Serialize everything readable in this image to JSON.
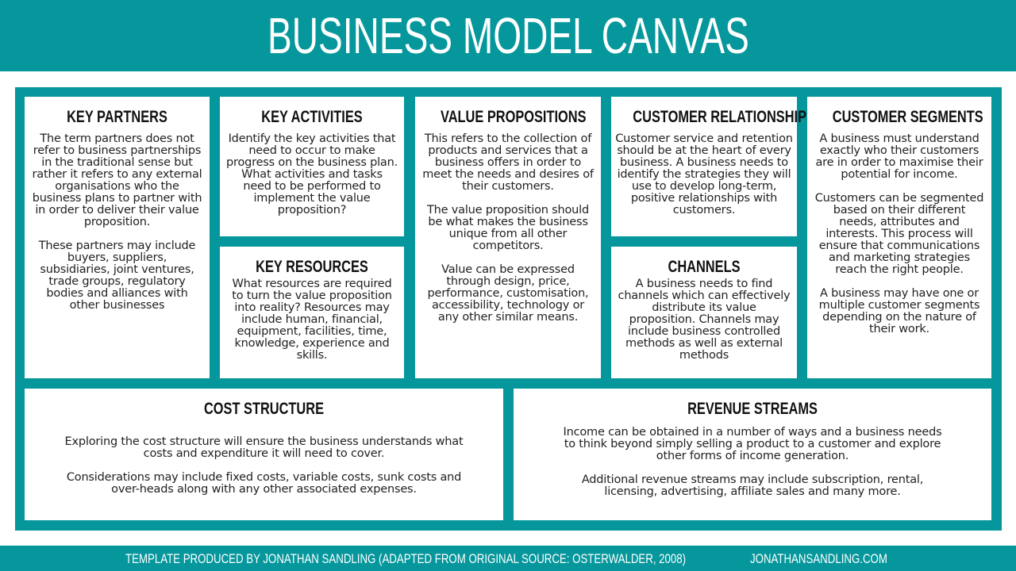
{
  "title": "BUSINESS MODEL CANVAS",
  "colors": {
    "brand_teal": "#05979c",
    "box_bg": "#ffffff",
    "text": "#222222"
  },
  "blocks": {
    "key_partners": {
      "heading": "KEY PARTNERS",
      "paragraphs": [
        "The term partners does not refer to business partnerships in the traditional sense but rather it refers to any external organisations who the business plans to partner with in order to deliver their value proposition.",
        "These partners may include buyers, suppliers, subsidiaries, joint ventures, trade groups, regulatory bodies and alliances with other businesses"
      ]
    },
    "key_activities": {
      "heading": "KEY ACTIVITIES",
      "paragraphs": [
        "Identify the key activities that need to occur to make progress on the business plan. What activities and tasks need to be performed to implement the value proposition?"
      ]
    },
    "key_resources": {
      "heading": "KEY RESOURCES",
      "paragraphs": [
        "What resources are required to turn the value proposition into reality? Resources may include human, financial, equipment, facilities, time, knowledge, experience and skills."
      ]
    },
    "value_propositions": {
      "heading": "VALUE PROPOSITIONS",
      "paragraphs": [
        "This refers to the collection of products and services that a business offers in order to meet the needs and desires of their customers.",
        "The value proposition should be what makes the business unique from all other competitors.",
        "Value can be expressed through design, price, performance, customisation, accessibility, technology or any other similar means."
      ]
    },
    "customer_relationships": {
      "heading": "CUSTOMER RELATIONSHIPS",
      "paragraphs": [
        "Customer service and retention should be at the heart of every business. A business needs to identify the strategies they will use to develop long-term, positive relationships with customers."
      ]
    },
    "channels": {
      "heading": "CHANNELS",
      "paragraphs": [
        "A business needs to find channels which can effectively distribute its value proposition. Channels may include business controlled methods as well as external methods"
      ]
    },
    "customer_segments": {
      "heading": "CUSTOMER SEGMENTS",
      "paragraphs": [
        "A business must understand exactly who their customers are in order to maximise their potential for income.",
        "Customers can be segmented based on their different needs, attributes and interests. This process will ensure that communications and marketing strategies reach the right people.",
        "A business may have one or multiple customer segments depending on the nature of their work."
      ]
    },
    "cost_structure": {
      "heading": "COST STRUCTURE",
      "paragraphs": [
        "Exploring the cost structure will ensure the business understands what costs and expenditure it will need to cover.",
        "Considerations may include fixed costs, variable costs, sunk costs and over-heads along with any other associated expenses."
      ]
    },
    "revenue_streams": {
      "heading": "REVENUE STREAMS",
      "paragraphs": [
        "Income can be obtained in a number of ways and a business needs to think beyond simply selling a product to a customer and explore other forms of income generation.",
        "Additional revenue streams may include subscription, rental, licensing, advertising, affiliate sales and many more."
      ]
    }
  },
  "footer": {
    "credit": "TEMPLATE PRODUCED BY JONATHAN SANDLING  (ADAPTED FROM ORIGINAL SOURCE: OSTERWALDER, 2008)",
    "website": "JONATHANSANDLING.COM"
  }
}
